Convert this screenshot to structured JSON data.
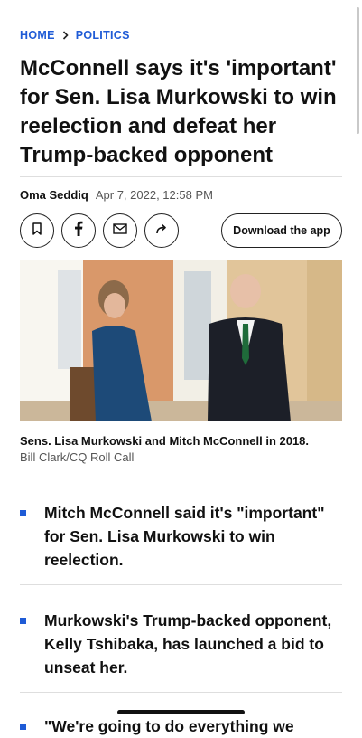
{
  "breadcrumb": {
    "home": "HOME",
    "section": "POLITICS"
  },
  "article": {
    "title": "McConnell says it's 'important' for Sen. Lisa Murkowski to win reelection and defeat her Trump-backed opponent",
    "author": "Oma Seddiq",
    "date": "Apr 7, 2022, 12:58 PM"
  },
  "share": {
    "icons": [
      "bookmark-icon",
      "facebook-icon",
      "mail-icon",
      "share-arrow-icon"
    ],
    "download_label": "Download the app"
  },
  "image": {
    "caption": "Sens. Lisa Murkowski and Mitch McConnell in 2018.",
    "credit": "Bill Clark/CQ Roll Call"
  },
  "bullets": [
    "Mitch McConnell said it's \"important\" for Sen. Lisa Murkowski to win reelection.",
    "Murkowski's Trump-backed opponent, Kelly Tshibaka, has launched a bid to unseat her.",
    "\"We're going to do everything we"
  ],
  "colors": {
    "accent": "#1f5bd6",
    "text": "#111111",
    "muted": "#555555"
  }
}
